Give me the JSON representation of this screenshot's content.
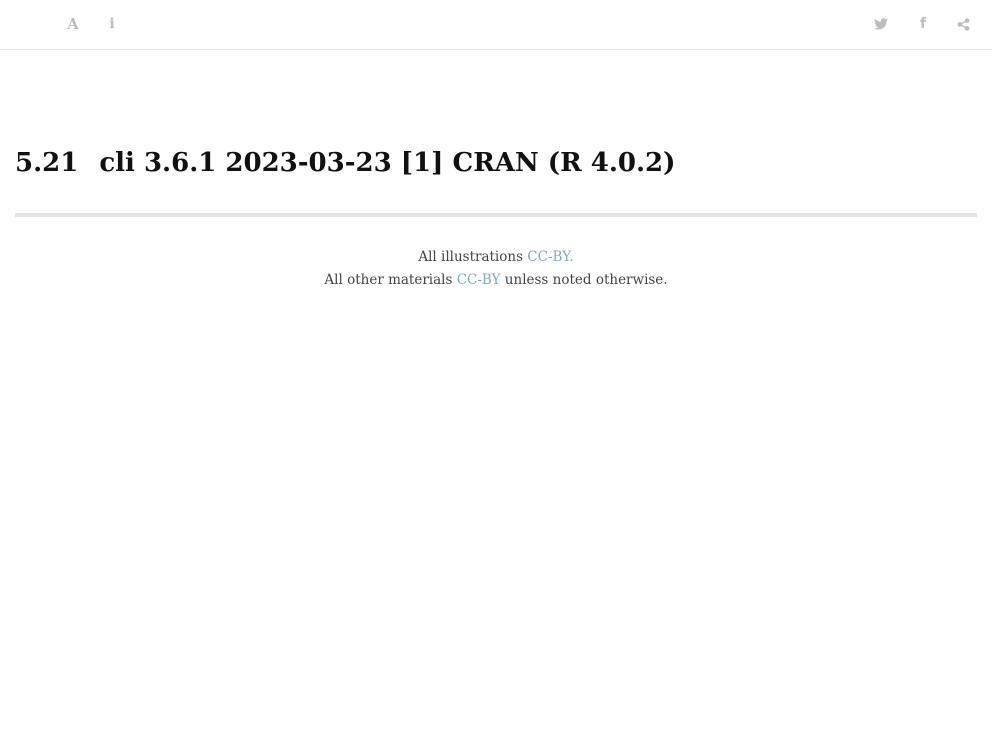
{
  "toolbar": {
    "left_icons": [
      "font-settings-icon",
      "info-icon"
    ],
    "right_icons": [
      "twitter-icon",
      "facebook-icon",
      "share-icon"
    ],
    "icon_color": "#bdbdbd"
  },
  "heading": {
    "number": "5.21",
    "text": "cli 3.6.1 2023-03-23 [1] CRAN (R 4.0.2)"
  },
  "footer": {
    "line1_prefix": "All illustrations ",
    "line1_link": "CC-BY.",
    "line2_prefix": "All other materials ",
    "line2_link": "CC-BY",
    "line2_suffix": " unless noted otherwise.",
    "link_color": "#7aa8d4"
  }
}
